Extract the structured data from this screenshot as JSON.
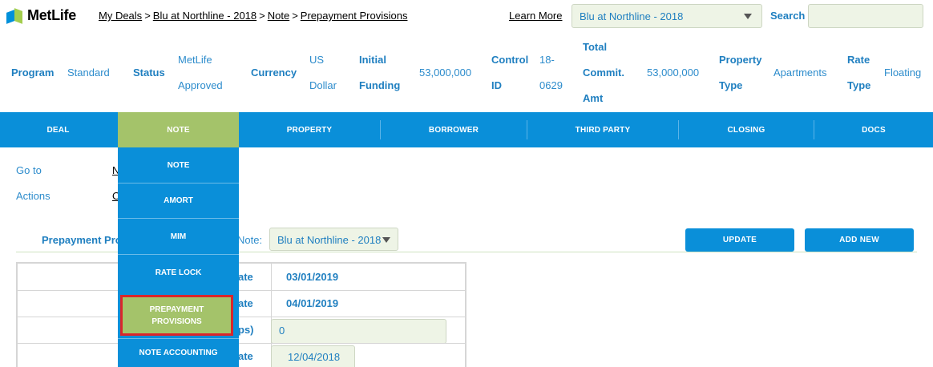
{
  "logo": {
    "text": "MetLife"
  },
  "breadcrumb": [
    "My Deals",
    "Blu at Northline - 2018",
    "Note",
    "Prepayment Provisions"
  ],
  "breadcrumb_sep": ">",
  "header": {
    "learn_more": "Learn More",
    "deal_select": "Blu at Northline - 2018",
    "search_label": "Search",
    "search_value": ""
  },
  "info": {
    "program_label": "Program",
    "program_value": "Standard",
    "status_label": "Status",
    "status_value_1": "MetLife",
    "status_value_2": "Approved",
    "currency_label": "Currency",
    "currency_value_1": "US",
    "currency_value_2": "Dollar",
    "initial_funding_label_1": "Initial",
    "initial_funding_label_2": "Funding",
    "initial_funding_value": "53,000,000",
    "control_id_label_1": "Control",
    "control_id_label_2": "ID",
    "control_id_value_1": "18-",
    "control_id_value_2": "0629",
    "total_commit_label_1": "Total",
    "total_commit_label_2": "Commit.",
    "total_commit_label_3": "Amt",
    "total_commit_value": "53,000,000",
    "property_type_label_1": "Property",
    "property_type_label_2": "Type",
    "property_type_value": "Apartments",
    "rate_type_label_1": "Rate",
    "rate_type_label_2": "Type",
    "rate_type_value": "Floating"
  },
  "nav": {
    "tabs": [
      "DEAL",
      "NOTE",
      "PROPERTY",
      "BORROWER",
      "THIRD PARTY",
      "CLOSING",
      "DOCS"
    ],
    "active": "NOTE"
  },
  "dropdown": {
    "items": [
      "NOTE",
      "AMORT",
      "MIM",
      "RATE LOCK",
      "PREPAYMENT",
      "PROVISIONS",
      "NOTE ACCOUNTING"
    ],
    "highlighted": "PREPAYMENT PROVISIONS"
  },
  "content": {
    "goto_label": "Go to",
    "goto_value": "N",
    "actions_label": "Actions",
    "actions_value": "O",
    "section_title": "Prepayment Pro",
    "note_label": "Note:",
    "note_select": "Blu at Northline - 2018",
    "update_button": "UPDATE",
    "add_new_button": "ADD NEW"
  },
  "table": {
    "rows": [
      {
        "label": "ate",
        "value": "03/01/2019"
      },
      {
        "label": "ate",
        "value": "04/01/2019"
      },
      {
        "label": "ps)",
        "value": "0"
      },
      {
        "label": "ate",
        "value": "12/04/2018"
      }
    ]
  },
  "colors": {
    "primary_blue": "#0a8fd9",
    "active_green": "#a4c36a",
    "highlight_red": "#d9262b",
    "input_bg": "#eef4e6"
  }
}
